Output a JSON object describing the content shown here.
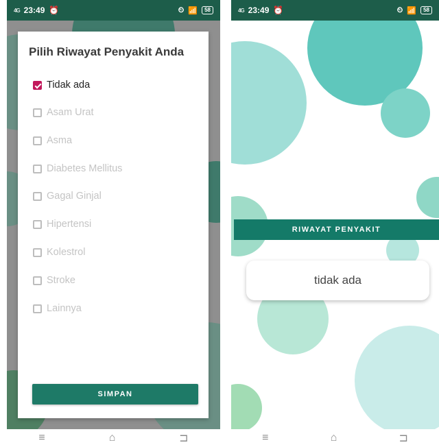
{
  "status_bar": {
    "network": "4G",
    "time": "23:49",
    "battery": "58"
  },
  "dialog": {
    "title": "Pilih Riwayat Penyakit Anda",
    "options": [
      {
        "label": "Tidak ada",
        "checked": true
      },
      {
        "label": "Asam Urat",
        "checked": false
      },
      {
        "label": "Asma",
        "checked": false
      },
      {
        "label": "Diabetes Mellitus",
        "checked": false
      },
      {
        "label": "Gagal Ginjal",
        "checked": false
      },
      {
        "label": "Hipertensi",
        "checked": false
      },
      {
        "label": "Kolestrol",
        "checked": false
      },
      {
        "label": "Stroke",
        "checked": false
      },
      {
        "label": "Lainnya",
        "checked": false
      }
    ],
    "save_label": "SIMPAN"
  },
  "profile": {
    "section_label": "RIWAYAT PENYAKIT",
    "value": "tidak ada"
  },
  "nav": {
    "menu_icon": "menu-icon",
    "home_icon": "home-icon",
    "back_icon": "back-icon"
  },
  "colors": {
    "primary": "#1e7a67",
    "status_bar": "#1d5d4a",
    "checkbox_accent": "#c2185b"
  }
}
